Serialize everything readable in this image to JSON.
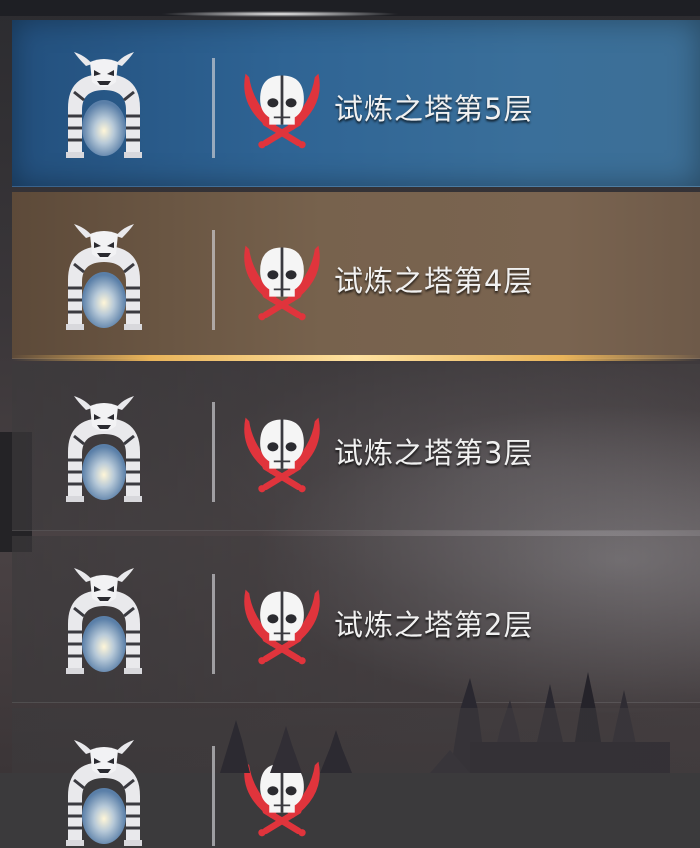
{
  "floors": [
    {
      "label": "试炼之塔第5层",
      "state": "selected"
    },
    {
      "label": "试炼之塔第4层",
      "state": "highlighted"
    },
    {
      "label": "试炼之塔第3层",
      "state": "normal"
    },
    {
      "label": "试炼之塔第2层",
      "state": "normal"
    },
    {
      "label": "",
      "state": "partial"
    }
  ],
  "icons": {
    "portal": "demon-arch-portal-icon",
    "battle": "skull-crossed-swords-icon"
  },
  "colors": {
    "selected_row": "#2f6494",
    "highlighted_row": "#77624d",
    "gold_trim": "#e9b45a",
    "swords": "#e0343c"
  }
}
